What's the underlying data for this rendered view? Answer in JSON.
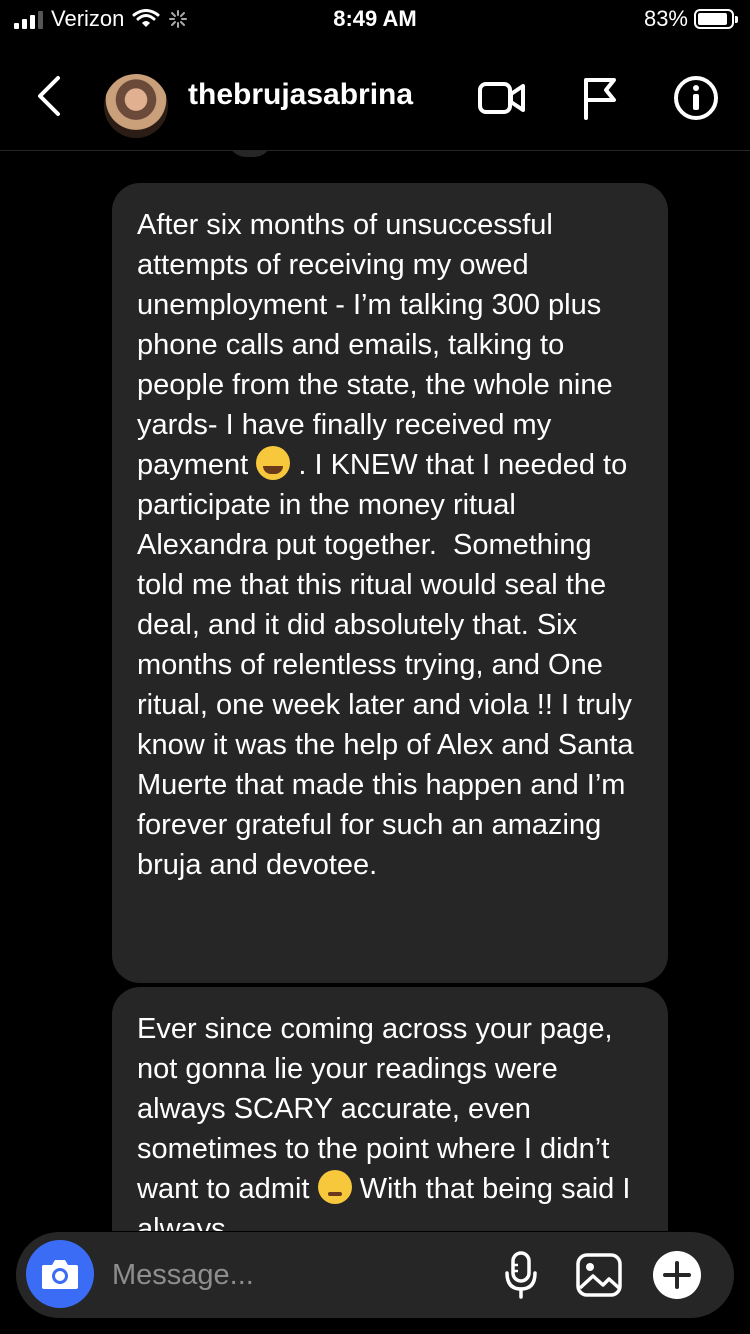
{
  "status_bar": {
    "carrier": "Verizon",
    "time": "8:49 AM",
    "battery": "83%"
  },
  "header": {
    "username": "thebrujasabrina"
  },
  "messages": [
    {
      "text": "After six months of unsuccessful attempts of receiving my owed unemployment - I’m talking 300 plus phone calls and emails, talking to people from the state, the whole nine yards- I have finally received my payment",
      "emoji": "loudly-crying-face",
      "text_after": " . I KNEW that I needed to participate in the money ritual Alexandra put together.  Something told me that this ritual would seal the deal, and it did absolutely that. Six months of relentless trying, and One ritual, one week later and viola !! I truly know it was the help of Alex and Santa Muerte that made this happen and I’m forever grateful for such an amazing bruja and devotee."
    },
    {
      "text": "Ever since coming across your page, not gonna lie your readings were always SCARY accurate, even sometimes to the point where I didn’t want to admit ",
      "emoji": "woozy-face",
      "text_after": " With that being said I always"
    }
  ],
  "composer": {
    "placeholder": "Message..."
  },
  "colors": {
    "background": "#000000",
    "bubble": "#262626",
    "camera_button": "#3b6cf5",
    "placeholder": "#8e8e8e"
  }
}
